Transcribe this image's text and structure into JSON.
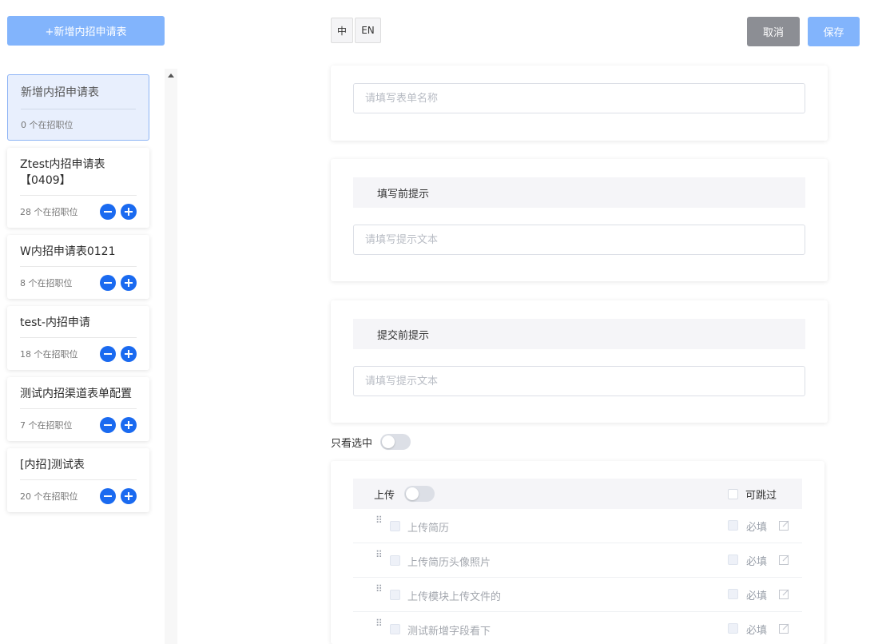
{
  "sidebar": {
    "add_button": "+新增内招申请表",
    "cards": [
      {
        "title": "新增内招申请表",
        "count": "0 个在招职位",
        "active": true
      },
      {
        "title": "Ztest内招申请表【0409】",
        "count": "28 个在招职位",
        "active": false
      },
      {
        "title": "W内招申请表0121",
        "count": "8 个在招职位",
        "active": false
      },
      {
        "title": "test-内招申请",
        "count": "18 个在招职位",
        "active": false
      },
      {
        "title": "测试内招渠道表单配置",
        "count": "7 个在招职位",
        "active": false
      },
      {
        "title": "[内招]测试表",
        "count": "20 个在招职位",
        "active": false
      }
    ]
  },
  "toolbar": {
    "lang_zh": "中",
    "lang_en": "EN",
    "cancel": "取消",
    "save": "保存"
  },
  "form": {
    "name_placeholder": "请填写表单名称",
    "before_fill": {
      "title": "填写前提示",
      "placeholder": "请填写提示文本"
    },
    "before_submit": {
      "title": "提交前提示",
      "placeholder": "请填写提示文本"
    },
    "only_selected": "只看选中",
    "upload": {
      "title": "上传",
      "skip_label": "可跳过",
      "required_label": "必填",
      "fields": [
        {
          "label": "上传简历"
        },
        {
          "label": "上传简历头像照片"
        },
        {
          "label": "上传模块上传文件的"
        },
        {
          "label": "测试新增字段看下"
        }
      ]
    }
  },
  "colors": {
    "primary": "#1a6af0",
    "primary_light": "#82b4fc",
    "cancel_gray": "#8c8e94"
  }
}
